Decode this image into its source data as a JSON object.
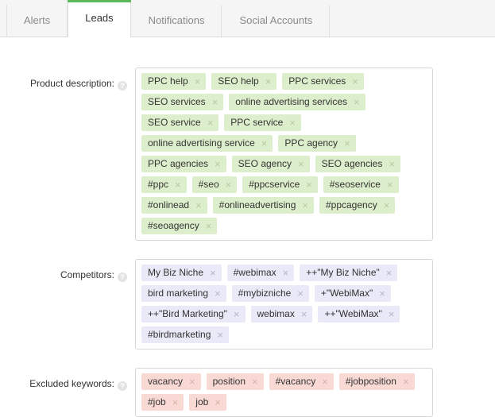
{
  "tabs": [
    {
      "label": "Alerts",
      "active": false
    },
    {
      "label": "Leads",
      "active": true
    },
    {
      "label": "Notifications",
      "active": false
    },
    {
      "label": "Social Accounts",
      "active": false
    }
  ],
  "help_glyph": "?",
  "close_glyph": "×",
  "colors": {
    "active_tab_accent": "#5cb85c",
    "tag_green": "#ddeecc",
    "tag_violet": "#e9e9f7",
    "tag_pink": "#f8d9d4",
    "tabbar_background": "#f5f5f5",
    "content_background": "#ffffff",
    "field_border": "#d5d5d5"
  },
  "fields": [
    {
      "label": "Product description:",
      "tone": "green",
      "tags": [
        "PPC help",
        "SEO help",
        "PPC services",
        "SEO services",
        "online advertising services",
        "SEO service",
        "PPC service",
        "online advertising service",
        "PPC agency",
        "PPC agencies",
        "SEO agency",
        "SEO agencies",
        "#ppc",
        "#seo",
        "#ppcservice",
        "#seoservice",
        "#onlinead",
        "#onlineadvertising",
        "#ppcagency",
        "#seoagency"
      ]
    },
    {
      "label": "Competitors:",
      "tone": "violet",
      "tags": [
        "My Biz Niche",
        "#webimax",
        "++\"My Biz Niche\"",
        "bird marketing",
        "#mybizniche",
        "+\"WebiMax\"",
        "++\"Bird Marketing\"",
        "webimax",
        "++\"WebiMax\"",
        "#birdmarketing"
      ]
    },
    {
      "label": "Excluded keywords:",
      "tone": "pink",
      "tags": [
        "vacancy",
        "position",
        "#vacancy",
        "#jobposition",
        "#job",
        "job"
      ]
    }
  ]
}
